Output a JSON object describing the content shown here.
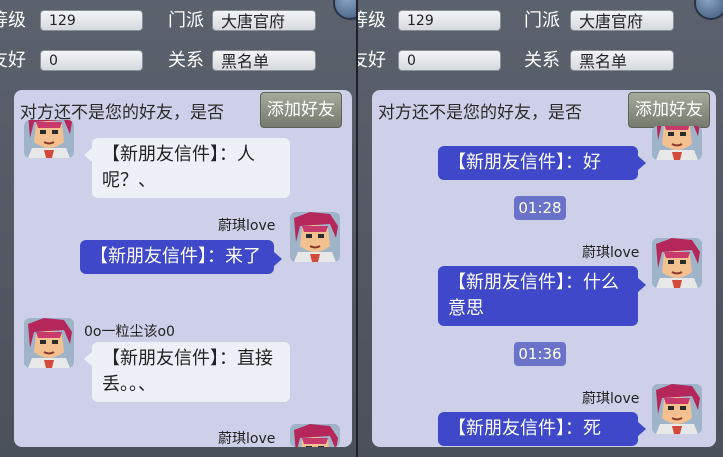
{
  "panel_left": {
    "level_label": "等级",
    "level_value": "129",
    "sect_label": "门派",
    "sect_value": "大唐官府",
    "friendship_label": "友好",
    "friendship_value": "0",
    "relation_label": "关系",
    "relation_value": "黑名单",
    "notice": "对方还不是您的好友，是否",
    "add_friend_button": "添加好友",
    "messages": [
      {
        "sender": "",
        "text": "【新朋友信件】：人呢？、"
      },
      {
        "sender": "蔚琪love",
        "text": "【新朋友信件】：来了"
      },
      {
        "sender": "0o一粒尘该o0",
        "text": "【新朋友信件】：直接丢。。、"
      },
      {
        "sender": "蔚琪love",
        "text": ""
      }
    ]
  },
  "panel_right": {
    "level_label": "等级",
    "level_value": "129",
    "sect_label": "门派",
    "sect_value": "大唐官府",
    "friendship_label": "友好",
    "friendship_value": "0",
    "relation_label": "关系",
    "relation_value": "黑名单",
    "notice": "对方还不是您的好友，是否",
    "add_friend_button": "添加好友",
    "messages": [
      {
        "sender": "",
        "text": "【新朋友信件】：好"
      },
      {
        "timestamp": "01:28"
      },
      {
        "sender": "蔚琪love",
        "text": "【新朋友信件】：什么意思"
      },
      {
        "timestamp": "01:36"
      },
      {
        "sender": "蔚琪love",
        "text": "【新朋友信件】：死"
      }
    ]
  },
  "icons": [
    "close-icon",
    "avatar-icon"
  ],
  "colors": {
    "own_bubble": "#3e48c8",
    "other_bubble": "#eef0f7",
    "chat_bg": "#cdd0e8",
    "timestamp_bg": "#6a72c9"
  }
}
